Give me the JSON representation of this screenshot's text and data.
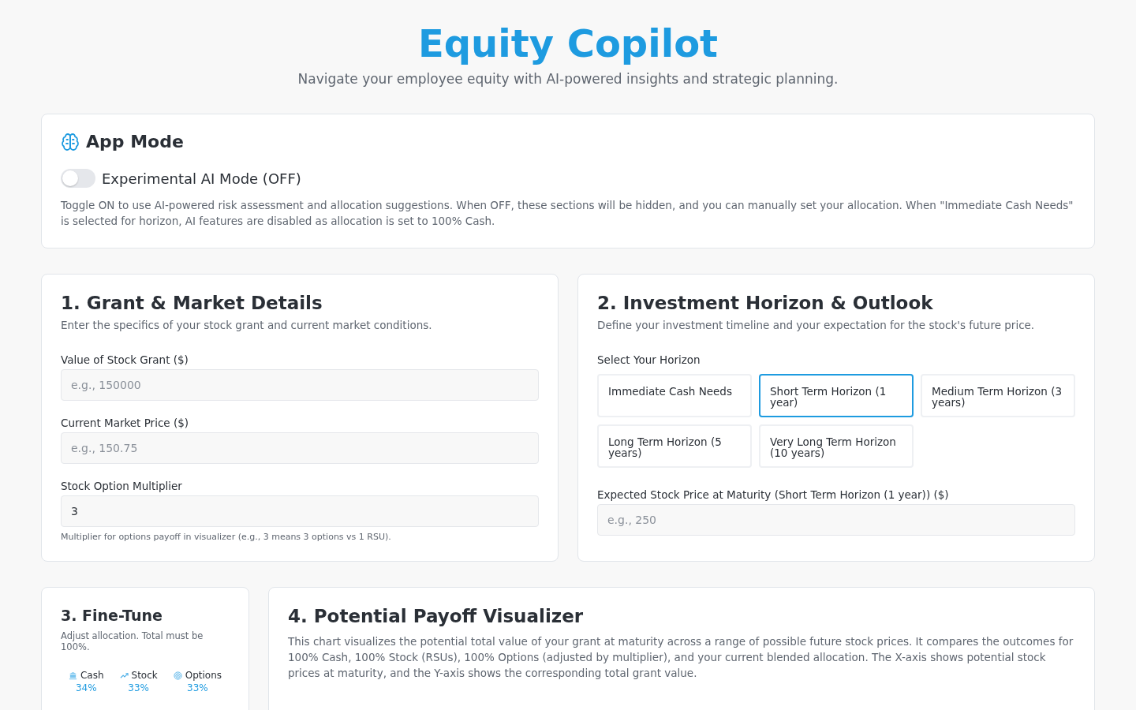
{
  "header": {
    "title": "Equity Copilot",
    "subtitle": "Navigate your employee equity with AI-powered insights and strategic planning."
  },
  "app_mode": {
    "title": "App Mode",
    "toggle": {
      "label": "Experimental AI Mode (OFF)",
      "on": false
    },
    "description": "Toggle ON to use AI-powered risk assessment and allocation suggestions. When OFF, these sections will be hidden, and you can manually set your allocation. When \"Immediate Cash Needs\" is selected for horizon, AI features are disabled as allocation is set to 100% Cash."
  },
  "grant": {
    "title": "1. Grant & Market Details",
    "description": "Enter the specifics of your stock grant and current market conditions.",
    "fields": [
      {
        "label": "Value of Stock Grant ($)",
        "placeholder": "e.g., 150000"
      },
      {
        "label": "Current Market Price ($)",
        "placeholder": "e.g., 150.75"
      },
      {
        "label": "Stock Option Multiplier",
        "value": "3",
        "hint": "Multiplier for options payoff in visualizer (e.g., 3 means 3 options vs 1 RSU)."
      }
    ]
  },
  "horizon": {
    "title": "2. Investment Horizon & Outlook",
    "description": "Define your investment timeline and your expectation for the stock's future price.",
    "select_label": "Select Your Horizon",
    "options": [
      {
        "label": "Immediate Cash Needs",
        "selected": false
      },
      {
        "label": "Short Term Horizon (1 year)",
        "selected": true
      },
      {
        "label": "Medium Term Horizon (3 years)",
        "selected": false
      },
      {
        "label": "Long Term Horizon (5 years)",
        "selected": false
      },
      {
        "label": "Very Long Term Horizon (10 years)",
        "selected": false
      }
    ],
    "price_field": {
      "label": "Expected Stock Price at Maturity (Short Term Horizon (1 year)) ($)",
      "placeholder": "e.g., 250"
    }
  },
  "fine_tune": {
    "title": "3. Fine-Tune",
    "description": "Adjust allocation. Total must be 100%.",
    "allocations": [
      {
        "kind": "cash",
        "label": "Cash",
        "percent": "34%"
      },
      {
        "kind": "stock",
        "label": "Stock",
        "percent": "33%"
      },
      {
        "kind": "options",
        "label": "Options",
        "percent": "33%"
      }
    ]
  },
  "visualizer": {
    "title": "4. Potential Payoff Visualizer",
    "description": "This chart visualizes the potential total value of your grant at maturity across a range of possible future stock prices. It compares the outcomes for 100% Cash, 100% Stock (RSUs), 100% Options (adjusted by multiplier), and your current blended allocation. The X-axis shows potential stock prices at maturity, and the Y-axis shows the corresponding total grant value."
  }
}
